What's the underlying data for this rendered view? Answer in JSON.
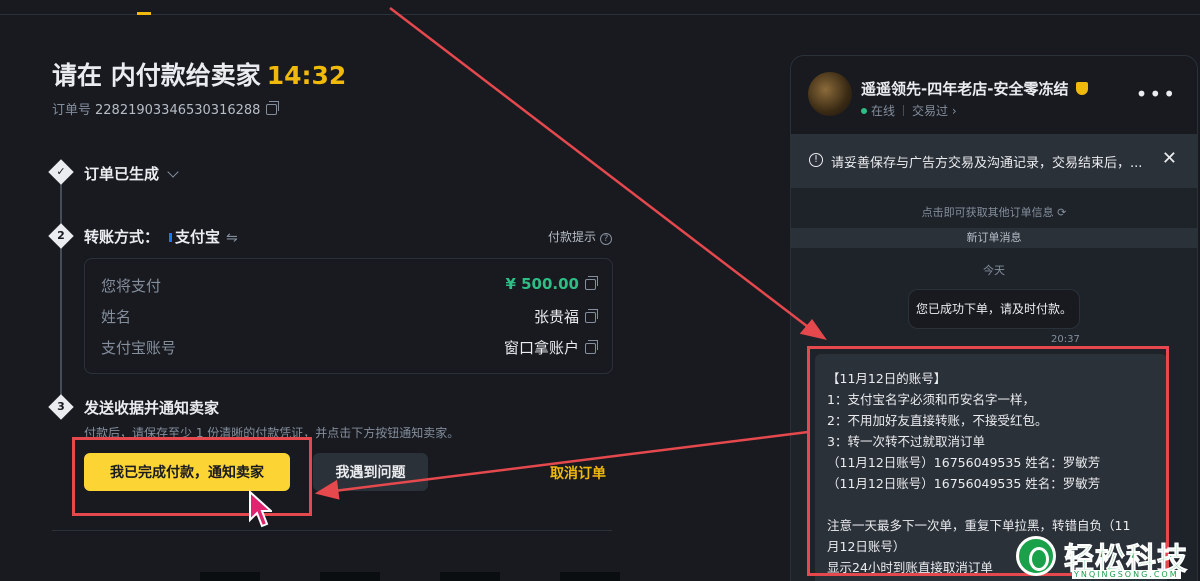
{
  "page": {
    "title_prefix": "请在 内付款给卖家",
    "timer": "14:32",
    "order_label": "订单号",
    "order_number": "22821903346530316288"
  },
  "steps": [
    {
      "num": "✓",
      "title": "订单已生成"
    },
    {
      "num": "2",
      "title": "转账方式：",
      "method": "支付宝",
      "hint": "付款提示"
    },
    {
      "num": "3",
      "title": "发送收据并通知卖家",
      "desc": "付款后，请保存至少 1 份清晰的付款凭证，并点击下方按钮通知卖家。"
    }
  ],
  "payment": {
    "rows": [
      {
        "label": "您将支付",
        "value": "¥ 500.00"
      },
      {
        "label": "姓名",
        "value": "张贵福"
      },
      {
        "label": "支付宝账号",
        "value": "窗口拿账户"
      }
    ]
  },
  "actions": {
    "confirm_label": "我已完成付款，通知卖家",
    "problem_label": "我遇到问题",
    "cancel_label": "取消订单"
  },
  "chat": {
    "shop_name": "遥遥领先-四年老店-安全零冻结",
    "status": "在线",
    "traded": "交易过 ›",
    "more": "•••",
    "notice": "请妥善保存与广告方交易及沟通记录，交易结束后，...",
    "more_orders": "点击即可获取其他订单信息 ⟳",
    "new_order_banner": "新订单消息",
    "today": "今天",
    "system_msg": "您已成功下单，请及时付款。",
    "system_time": "20:37",
    "message_lines": [
      "【11月12日的账号】",
      "1：支付宝名字必须和币安名字一样，",
      "2：不用加好友直接转账，不接受红包。",
      "3：转一次转不过就取消订单",
      "（11月12日账号）16756049535 姓名：罗敏芳",
      "（11月12日账号）16756049535 姓名：罗敏芳",
      "",
      " 注意一天最多下一次单，重复下单拉黑，转错自负（11",
      "月12日账号）",
      " 显示24小时到账直接取消订单"
    ]
  },
  "watermark": {
    "text": "轻松科技",
    "sub": "YNQINGSONG.COM"
  },
  "colors": {
    "accent": "#f0b90b",
    "button": "#fcd535",
    "positive": "#2ebd85",
    "annotation": "#e5484d",
    "watermark": "#1aa14a"
  }
}
